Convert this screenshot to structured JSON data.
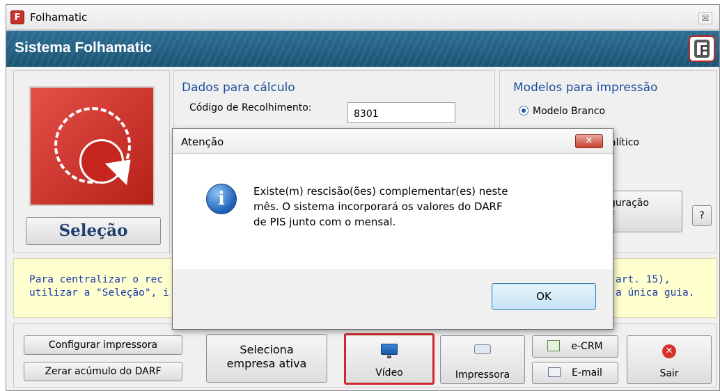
{
  "window": {
    "title": "Folhamatic",
    "close_glyph": "☒"
  },
  "banner": {
    "title": "Sistema Folhamatic",
    "logo_letter": "F"
  },
  "selecao": {
    "button_label": "Seleção"
  },
  "dados": {
    "section_title": "Dados para cálculo",
    "codigo_label": "Código de Recolhimento:",
    "codigo_value": "8301"
  },
  "modelos": {
    "section_title": "Modelos para impressão",
    "option_branco": "Modelo Branco",
    "option_analitico_partial": "alítico",
    "config_button_partial": "guração",
    "config_button_partial2": "F",
    "help_button": "?"
  },
  "info": {
    "line1_left": "Para centralizar o rec",
    "line1_right": "art. 15),",
    "line2_left": "utilizar a \"Seleção\", i",
    "line2_right": "a única guia."
  },
  "bottom": {
    "configurar_impressora": "Configurar impressora",
    "zerar_acumulo": "Zerar acúmulo do DARF",
    "seleciona_empresa_line1": "Seleciona",
    "seleciona_empresa_line2": "empresa ativa",
    "video_label": "Vídeo",
    "impressora_label": "Impressora",
    "ecrm_label": "e-CRM",
    "email_label": "E-mail",
    "sair_label": "Sair"
  },
  "dialog": {
    "title": "Atenção",
    "close_glyph": "✕",
    "message_line1": "Existe(m) rescisão(ões) complementar(es) neste",
    "message_line2": "mês. O sistema incorporará os valores do DARF",
    "message_line3": "de PIS junto com o mensal.",
    "ok_label": "OK"
  },
  "colors": {
    "banner": "#1b5575",
    "section_title": "#1c4f9c",
    "info_bg": "#ffffd0",
    "info_text": "#1a3aa8",
    "video_highlight": "#d1262c"
  }
}
